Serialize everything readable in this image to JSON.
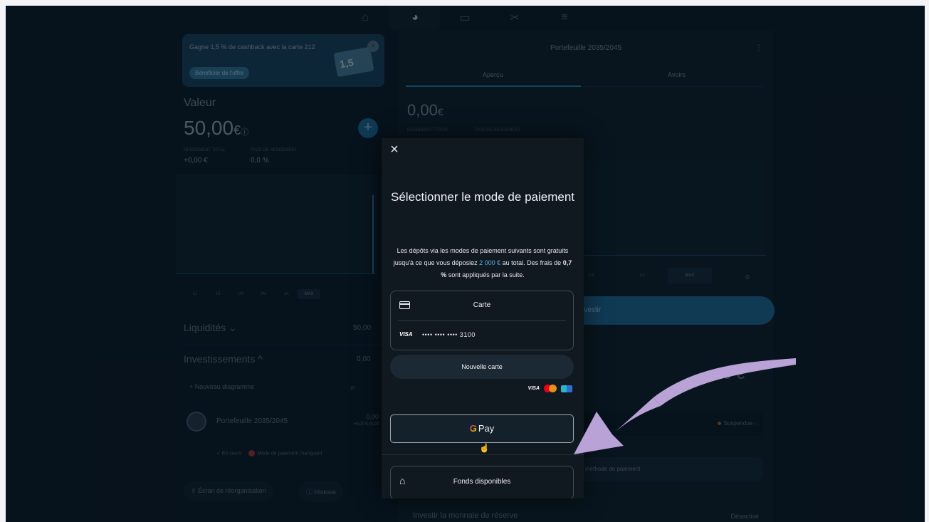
{
  "nav": {
    "icons": [
      "home-icon",
      "pie-chart-icon",
      "card-icon",
      "tools-icon",
      "menu-icon"
    ]
  },
  "promo": {
    "text": "Gagne 1,5 % de cashback avec la carte 212",
    "button": "Bénéficier de l'offre",
    "card_text": "1,5"
  },
  "wallet": {
    "value_label": "Valeur",
    "value_main": "50,00",
    "value_currency": "€",
    "total_return_label": "RENDEMENT TOTAL",
    "total_return": "+0,00 €",
    "return_rate_label": "TAUX DE RENDEMENT",
    "return_rate": "0,0 %"
  },
  "ranges_left": [
    "1J",
    "1S",
    "1M",
    "3M",
    "1A",
    "MAX"
  ],
  "liquidites": {
    "label": "Liquidités",
    "value": "50,00"
  },
  "investissements": {
    "label": "Investissements",
    "value": "0,00"
  },
  "new_diagram": "+ Nouveau diagramme",
  "portfolio_row": {
    "name": "Portefeuille 2035/2045",
    "value": "0,00",
    "sub": "+0,00 € (0,00"
  },
  "status": {
    "ongoing": "✓ En cours",
    "missing": "Mode de paiement manquant"
  },
  "footer": {
    "reorg": "Écran de réorganisation",
    "history": "Histoire"
  },
  "right": {
    "title": "Portefeuille 2035/2045",
    "tab_overview": "Aperçu",
    "tab_notes": "Avoirs",
    "amount": "0,00",
    "currency": "€",
    "total_return_label": "RENDEMENT TOTAL",
    "return_rate_label": "TAUX DE RENDEMENT",
    "ranges": [
      "3M",
      "1A"
    ],
    "max": "MAX",
    "invest": "Investir",
    "suspended": "Suspendue",
    "method": "méthode de paiement",
    "reserve": "Investir la monnaie de réserve",
    "reserve_status": "Désactivé"
  },
  "modal": {
    "title": "Sélectionner le mode de paiement",
    "desc_1": "Les dépôts via les modes de paiement suivants sont gratuits jusqu'à ce que vous déposiez ",
    "desc_highlight": "2 000 €",
    "desc_2": " au total. Des frais de ",
    "desc_bold": "0,7 %",
    "desc_3": " sont appliqués par la suite.",
    "card_title": "Carte",
    "card_brand": "VISA",
    "card_number": "•••• •••• •••• 3100",
    "new_card": "Nouvelle carte",
    "brands": [
      "VISA"
    ],
    "gpay_g": "G",
    "gpay_label": "Pay",
    "funds": "Fonds disponibles"
  },
  "colors": {
    "accent": "#2f84bd",
    "arrow": "#b8a2d6",
    "background": "#0b1a26"
  }
}
